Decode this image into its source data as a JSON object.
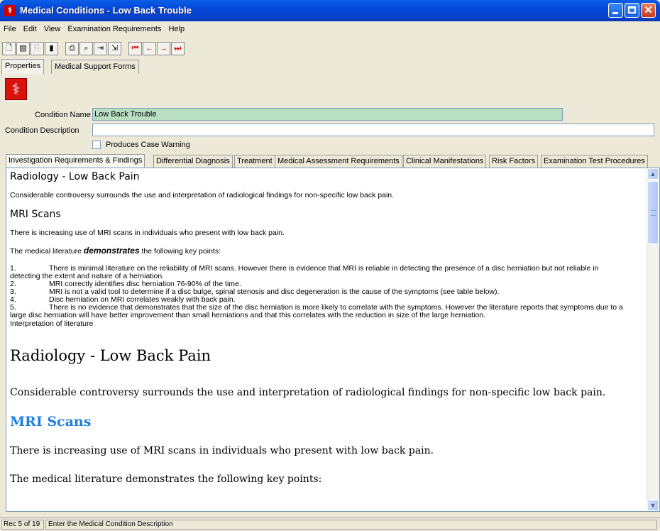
{
  "window": {
    "title": "Medical Conditions - Low Back Trouble",
    "icon": "caduceus-icon"
  },
  "menu": [
    "File",
    "Edit",
    "View",
    "Examination Requirements",
    "Help"
  ],
  "toolbar": {
    "buttons": [
      "new-icon",
      "open-icon",
      "copy-icon",
      "delete-icon",
      "print-icon",
      "find-icon",
      "export-icon",
      "exit-icon",
      "first-record-icon",
      "previous-record-icon",
      "next-record-icon",
      "last-record-icon"
    ]
  },
  "top_tabs": [
    "Properties",
    "Medical Support Forms"
  ],
  "form": {
    "condition_name_label": "Condition Name",
    "condition_name_value": "Low Back Trouble",
    "condition_description_label": "Condition Description",
    "condition_description_value": "",
    "produces_case_warning_label": "Produces Case Warning",
    "produces_case_warning_checked": false
  },
  "section_tabs": [
    "Investigation Requirements & Findings",
    "Differential Diagnosis",
    "Treatment",
    "Medical Assessment Requirements",
    "Clinical Manifestations",
    "Risk Factors",
    "Examination Test Procedures"
  ],
  "content": {
    "heading1": "Radiology - Low Back Pain",
    "intro": "Considerable controversy surrounds the use and interpretation of radiological findings for non-specific low back pain.",
    "heading2": "MRI Scans",
    "mri_intro": "There is increasing use of MRI scans in individuals who present with low back pain.",
    "key_points_prefix": "The medical literature",
    "key_points_emph": "demonstrates",
    "key_points_suffix": "the following key points:",
    "points": [
      {
        "n": "1.",
        "text": "There is minimal literature on the reliability of MRI scans.  However there is evidence that MRI is reliable in detecting the presence of a disc herniation but not reliable in",
        "cont": "detecting the extent and nature of a herniation."
      },
      {
        "n": "2.",
        "text": "MRI correctly identifies disc herniation 76-90% of the time.",
        "cont": ""
      },
      {
        "n": "3.",
        "text": "MRI is not a valid tool to determine if a disc bulge, spinal stenosis and disc degeneration is the cause of the symptoms (see table below).",
        "cont": ""
      },
      {
        "n": "4.",
        "text": "Disc herniation on MRI correlates weakly with back pain.",
        "cont": ""
      },
      {
        "n": "5.",
        "text": "There is no evidence that demonstrates that the size of the disc herniation is more likely to correlate with the symptoms.  However the literature reports that symptoms due to a",
        "cont": "large disc herniation will have better improvement than small herniations and that this correlates with the reduction in size of the large herniation."
      }
    ],
    "interpretation": "Interpretation of literature",
    "large_heading1": "Radiology - Low Back Pain",
    "large_intro": "Considerable controversy surrounds the use and interpretation of radiological findings for non-specific low back pain.",
    "large_heading2": "MRI Scans",
    "large_mri_intro": "There is increasing use of MRI scans in individuals who present with low back pain.",
    "large_key_points": "The medical literature demonstrates the following key points:"
  },
  "status": {
    "record": "Rec 5 of 19",
    "message": "Enter the Medical Condition Description"
  },
  "colors": {
    "title_bar": "#0447d6",
    "name_field_bg": "#b9dfc3",
    "mri_heading": "#1f7fe0"
  }
}
